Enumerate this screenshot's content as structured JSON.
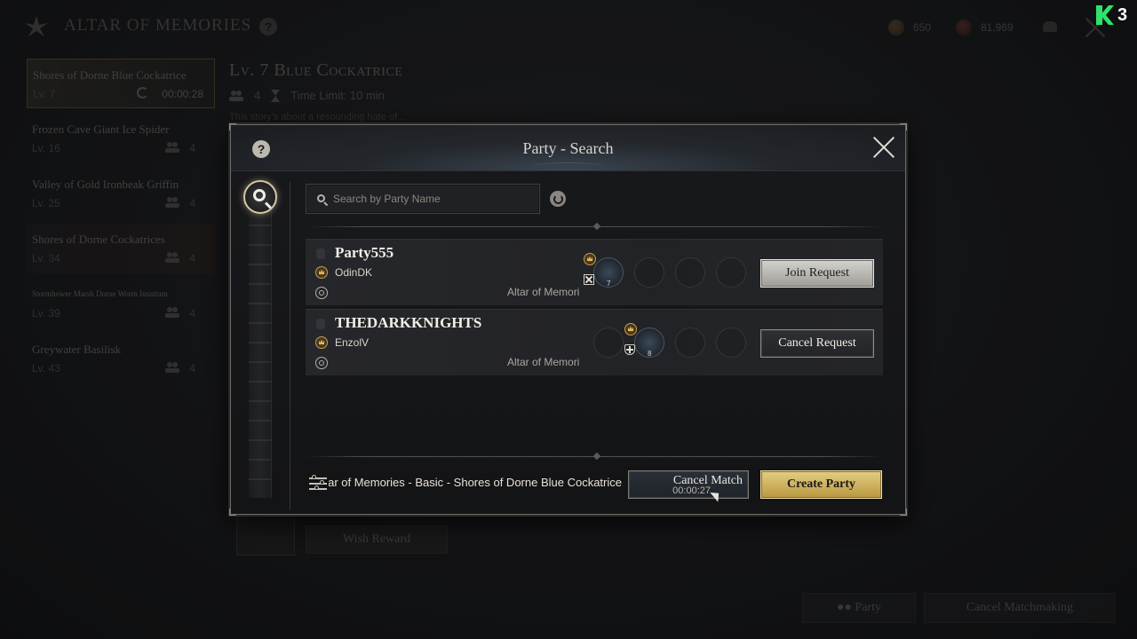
{
  "background": {
    "title": "ALTAR OF MEMORIES",
    "currency": [
      {
        "icon": "bronze-coin-icon",
        "value": "650"
      },
      {
        "icon": "red-coin-icon",
        "value": "81,969"
      }
    ],
    "stages": [
      {
        "name": "Shores of Dorne Blue Cockatrice",
        "level": "Lv. 7",
        "timer": "00:00:28",
        "active": true
      },
      {
        "name": "Frozen Cave Giant Ice Spider",
        "level": "Lv. 16",
        "count": "4"
      },
      {
        "name": "Valley of Gold Ironbeak Griffin",
        "level": "Lv. 25",
        "count": "4"
      },
      {
        "name": "Shores of Dorne Cockatrices",
        "level": "Lv. 34",
        "count": "4"
      },
      {
        "name": "Stormhower Marsh Dorne Worm Insatium",
        "level": "Lv. 39",
        "count": "4"
      },
      {
        "name": "Greywater Basilisk",
        "level": "Lv. 43",
        "count": "4"
      }
    ],
    "detail": {
      "title": "Lv. 7 Blue Cockatrice",
      "party_size": "4",
      "time_limit": "Time Limit: 10 min",
      "story": "This story's about a resounding hate of..."
    },
    "wish_reward_label": "Wish Reward",
    "party_button_label": "Party",
    "cancel_matchmaking_label": "Cancel Matchmaking"
  },
  "modal": {
    "title": "Party - Search",
    "search": {
      "placeholder": "Search by Party Name",
      "value": ""
    },
    "parties": [
      {
        "name": "Party555",
        "leader": "OdinDK",
        "dungeon": "Altar of Memori",
        "leader_slot": 1,
        "leader_class": "swords-icon",
        "leader_level": "7",
        "action_label": "Join Request",
        "action_style": "light"
      },
      {
        "name": "THEDARKKNIGHTS",
        "leader": "EnzolV",
        "dungeon": "Altar of Memori",
        "leader_slot": 2,
        "leader_class": "shield-icon",
        "leader_level": "8",
        "action_label": "Cancel Request",
        "action_style": "dark"
      }
    ],
    "footer": {
      "status": "Altar of Memories - Basic - Shores of Dorne Blue Cockatrice",
      "cancel_match_label": "Cancel Match",
      "timer": "00:00:27",
      "create_party_label": "Create Party"
    }
  },
  "watermark": {
    "number": "3"
  }
}
